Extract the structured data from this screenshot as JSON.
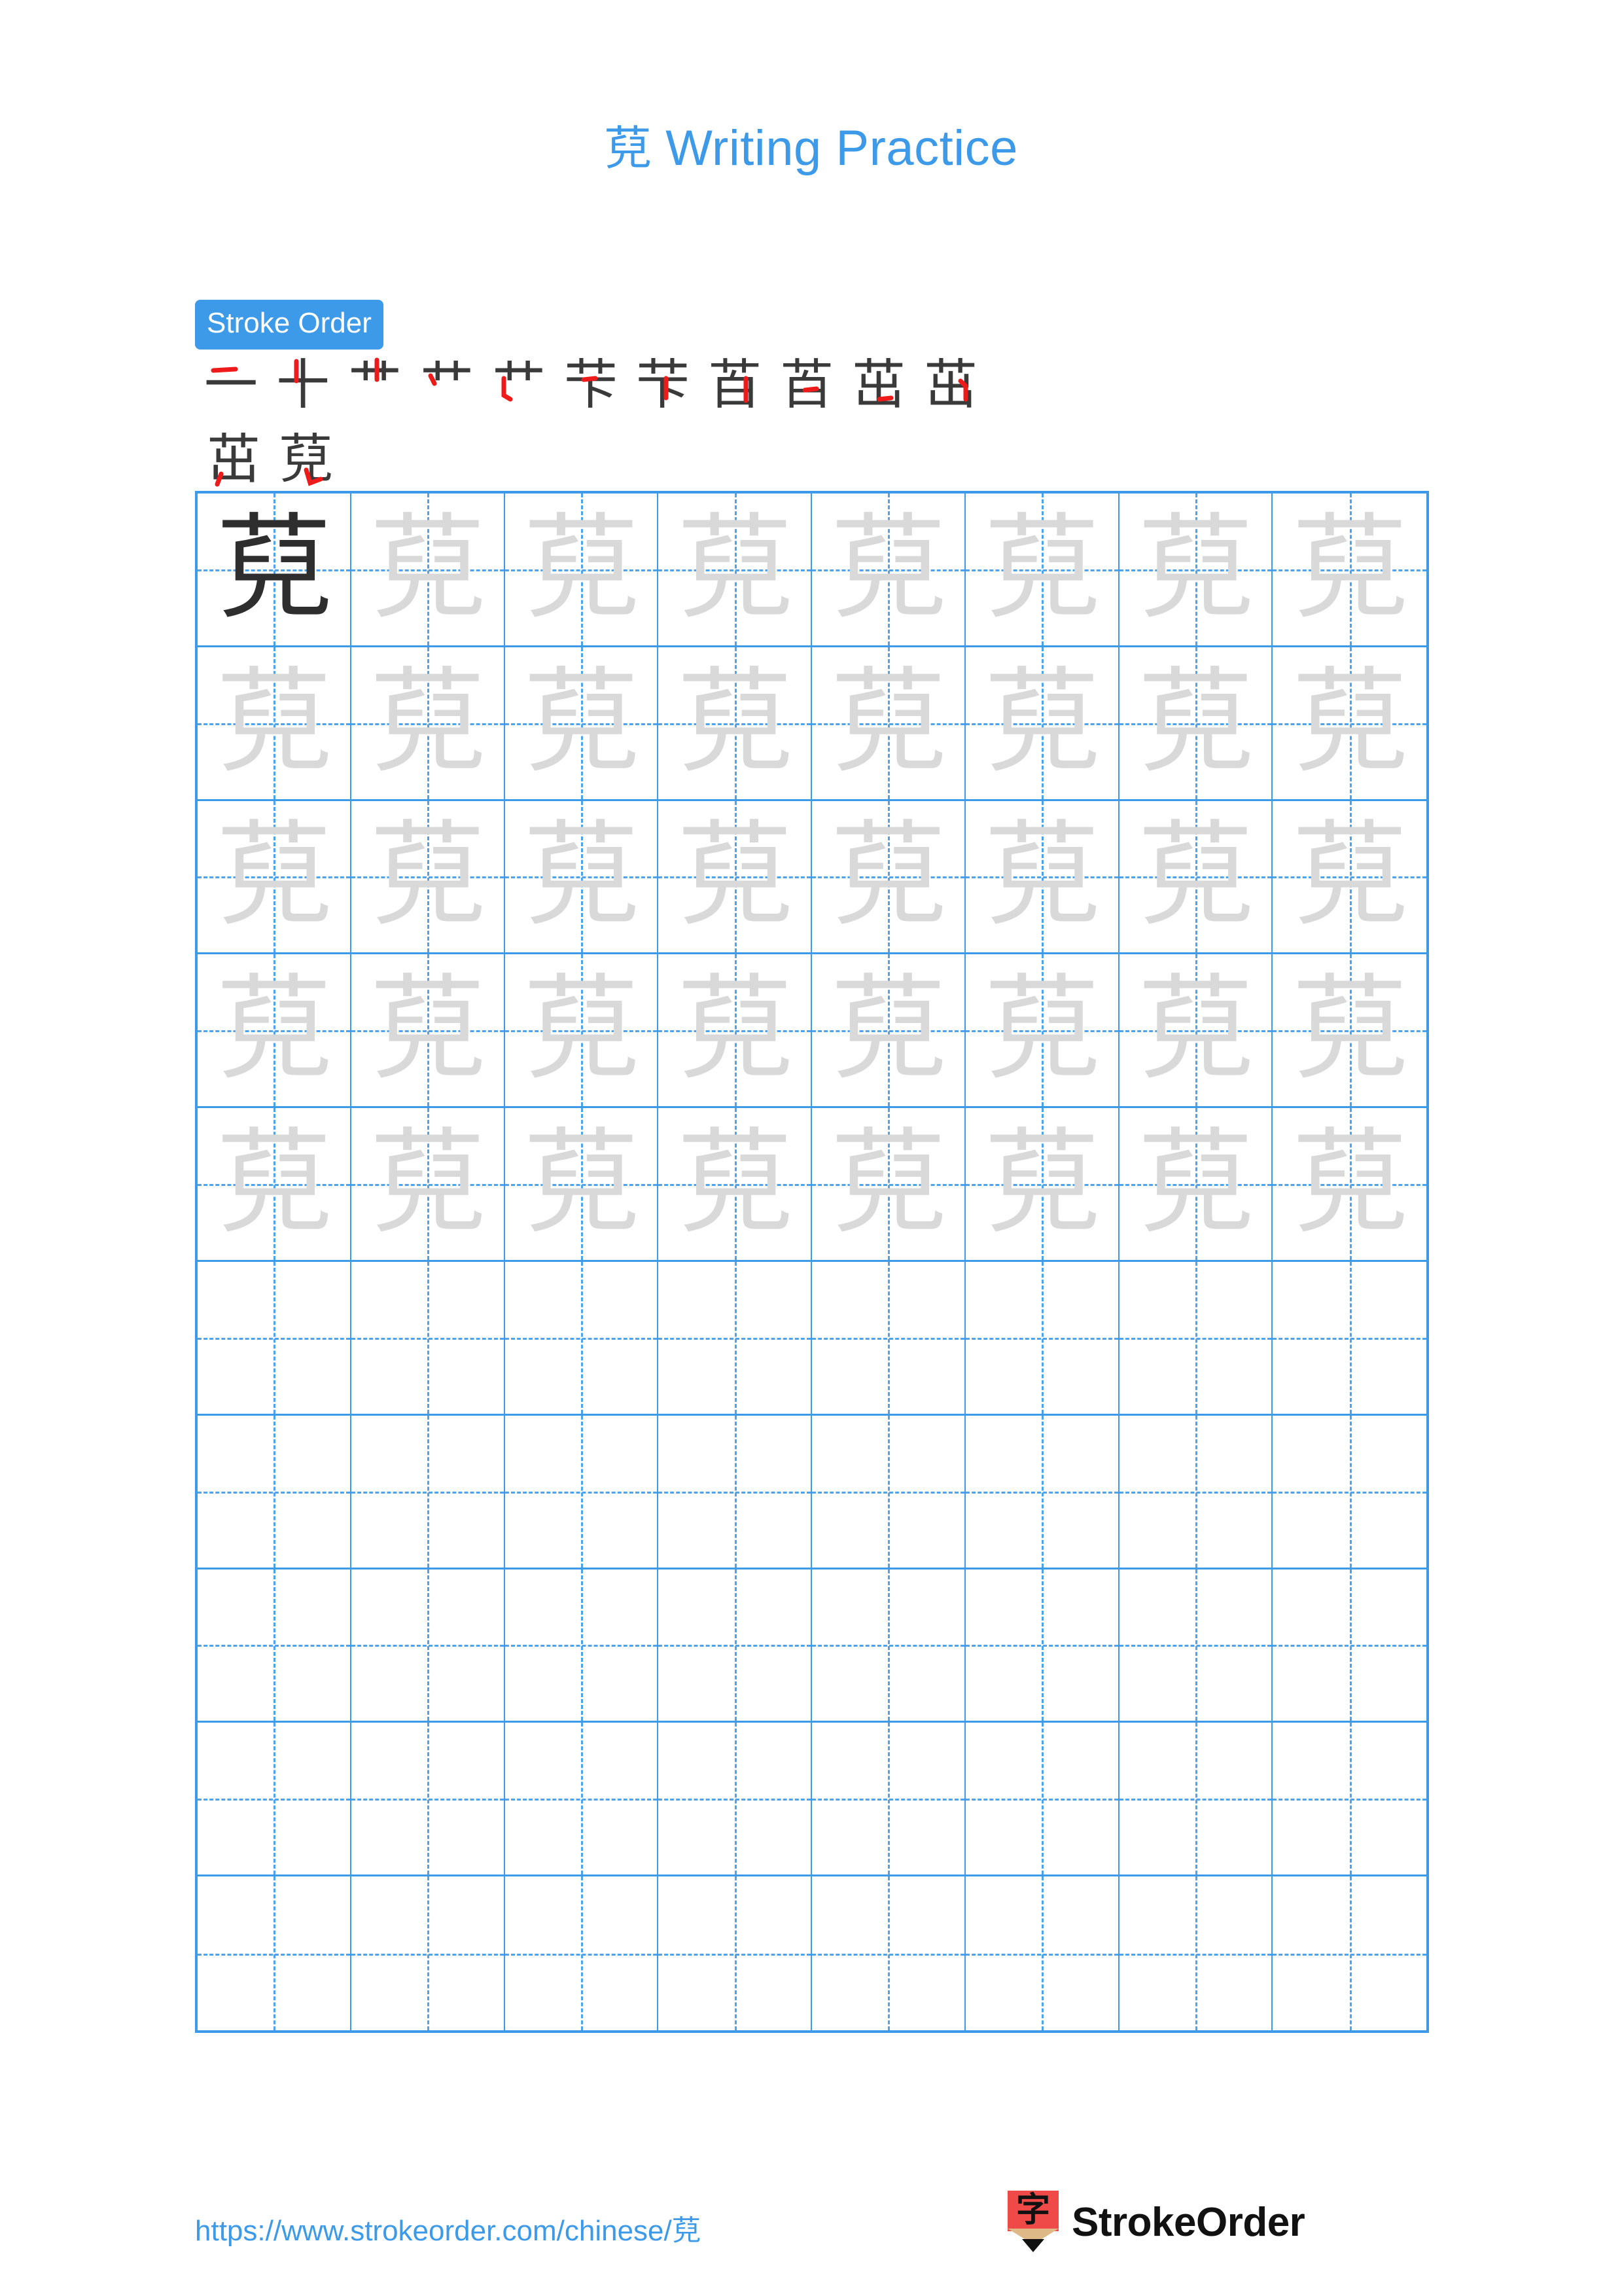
{
  "character": "萖",
  "title": {
    "character": "萖",
    "text": " Writing Practice"
  },
  "stroke_order": {
    "badge_label": "Stroke Order",
    "stroke_count": 13,
    "rows": [
      {
        "steps": [
          {
            "index": 1,
            "glyph": "一"
          },
          {
            "index": 2,
            "glyph": "十"
          },
          {
            "index": 3,
            "glyph": "艹"
          },
          {
            "index": 4,
            "glyph": "艹"
          },
          {
            "index": 5,
            "glyph": "艹"
          },
          {
            "index": 6,
            "glyph": "芐"
          },
          {
            "index": 7,
            "glyph": "芐"
          },
          {
            "index": 8,
            "glyph": "苩"
          },
          {
            "index": 9,
            "glyph": "苩"
          },
          {
            "index": 10,
            "glyph": "茁"
          },
          {
            "index": 11,
            "glyph": "茁"
          }
        ]
      },
      {
        "steps": [
          {
            "index": 12,
            "glyph": "茁"
          },
          {
            "index": 13,
            "glyph": "萖"
          }
        ]
      }
    ]
  },
  "practice_grid": {
    "columns": 8,
    "rows": 10,
    "model_cell": {
      "row": 1,
      "column": 1,
      "character": "萖"
    },
    "traced_rows": 5,
    "blank_rows": 5,
    "character": "萖"
  },
  "footer": {
    "url_prefix": "https://www.strokeorder.com/chinese/",
    "url_character": "萖",
    "brand_name": "StrokeOrder",
    "brand_logo_glyph": "字"
  },
  "colors": {
    "accent_blue": "#3d9ae9",
    "grid_blue": "#3d9ae9",
    "guide_blue": "#4ea3ec",
    "trace_gray": "#d9d9d9",
    "model_black": "#2e2e2e",
    "stroke_new_red": "#ef1b1b",
    "stroke_done_black": "#3a3a3a",
    "logo_red": "#f04a48",
    "logo_wood": "#deb887"
  }
}
